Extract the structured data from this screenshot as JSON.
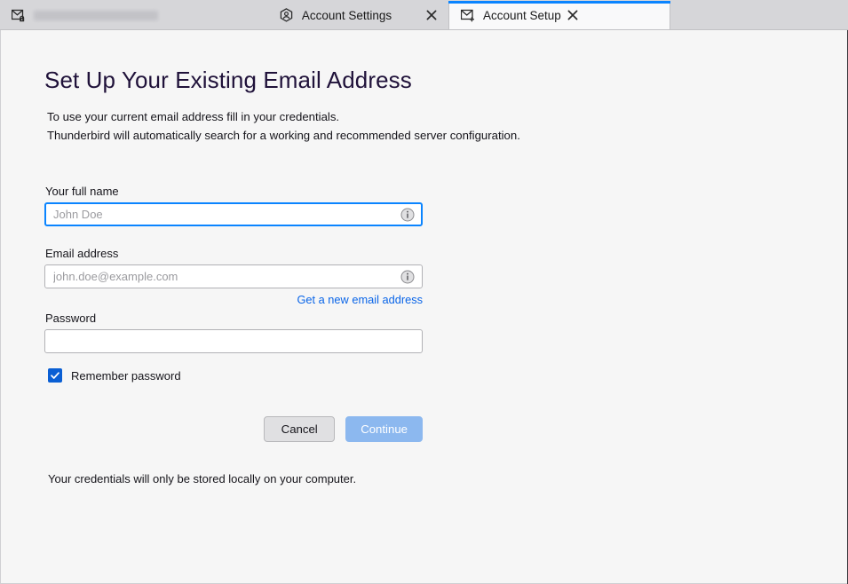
{
  "window": {
    "accent_blue": "#0a84ff",
    "tabbar_bg": "#d6d6d9",
    "content_bg": "#f6f6f6"
  },
  "tabs": [
    {
      "id": "mail-account",
      "label": "",
      "icon": "envelope-lock-icon",
      "active": false,
      "redacted": true,
      "has_close": false
    },
    {
      "id": "account-settings",
      "label": "Account Settings",
      "icon": "account-hexagon-icon",
      "active": false,
      "redacted": false,
      "has_close": true,
      "close_label": "Close tab"
    },
    {
      "id": "account-setup",
      "label": "Account Setup",
      "icon": "envelope-plus-icon",
      "active": true,
      "redacted": false,
      "has_close": true,
      "close_label": "Close tab"
    }
  ],
  "setup": {
    "title": "Set Up Your Existing Email Address",
    "subtitle_line1": "To use your current email address fill in your credentials.",
    "subtitle_line2": "Thunderbird will automatically search for a working and recommended server configuration.",
    "fields": {
      "full_name": {
        "label": "Your full name",
        "value": "",
        "placeholder": "John Doe",
        "focused": true,
        "info_icon": "info-circle-icon"
      },
      "email": {
        "label": "Email address",
        "value": "",
        "placeholder": "john.doe@example.com",
        "focused": false,
        "info_icon": "info-circle-icon"
      },
      "password": {
        "label": "Password",
        "value": "",
        "placeholder": "",
        "focused": false
      }
    },
    "new_email_link": "Get a new email address",
    "remember_password": {
      "label": "Remember password",
      "checked": true
    },
    "buttons": {
      "cancel": "Cancel",
      "continue": "Continue",
      "continue_disabled": true
    },
    "footer_note": "Your credentials will only be stored locally on your computer."
  }
}
